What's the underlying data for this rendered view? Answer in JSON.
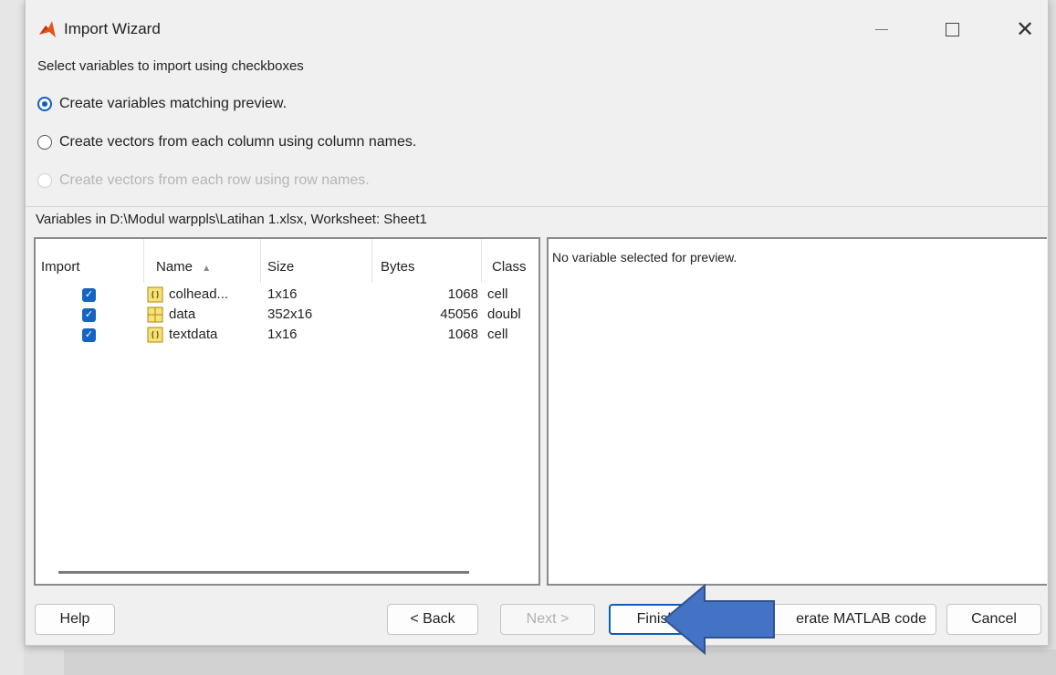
{
  "window": {
    "title": "Import Wizard"
  },
  "options": {
    "instruction": "Select variables to import using checkboxes",
    "radio_matching": "Create variables matching preview.",
    "radio_columns": "Create vectors from each column using column names.",
    "radio_rows": "Create vectors from each row using row names."
  },
  "vars_label": "Variables in D:\\Modul warppls\\Latihan 1.xlsx, Worksheet: Sheet1",
  "table": {
    "headers": {
      "import": "Import",
      "name": "Name",
      "sort_arrow": "▲",
      "size": "Size",
      "bytes": "Bytes",
      "class": "Class"
    },
    "rows": [
      {
        "name": "colhead...",
        "size": "1x16",
        "bytes": "1068",
        "class": "cell",
        "icon": "cell-icon",
        "checked": true
      },
      {
        "name": "data",
        "size": "352x16",
        "bytes": "45056",
        "class": "doubl",
        "icon": "matrix-icon",
        "checked": true
      },
      {
        "name": "textdata",
        "size": "1x16",
        "bytes": "1068",
        "class": "cell",
        "icon": "cell-icon",
        "checked": true
      }
    ]
  },
  "preview": {
    "text": "No variable selected for preview."
  },
  "buttons": {
    "help": "Help",
    "back": "< Back",
    "next": "Next >",
    "finish": "Finish",
    "generate": "erate MATLAB code",
    "cancel": "Cancel"
  },
  "colors": {
    "accent": "#0a5fc2",
    "arrow": "#4472c4",
    "checkbox": "#1565c0"
  }
}
